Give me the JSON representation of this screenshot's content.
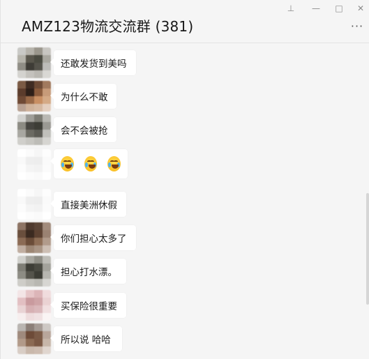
{
  "window": {
    "title": "AMZ123物流交流群 (381)",
    "controls": {
      "pin": "⊥",
      "minimize": "—",
      "maximize": "□",
      "close": "✕"
    },
    "more_label": "···"
  },
  "messages": [
    {
      "text": "还敢发货到美吗",
      "avatar": [
        "#c9c9c6",
        "#b6b3ab",
        "#9a968c",
        "#c8c6c1",
        "#b5b3aa",
        "#5a574d",
        "#4a4a40",
        "#a9a79f",
        "#8f8d85",
        "#3e3c36",
        "#55534b",
        "#bdbcb8",
        "#d4d3cf",
        "#c4c2bd",
        "#bab8b2",
        "#d9d8d4"
      ]
    },
    {
      "text": "为什么不敢",
      "avatar": [
        "#7b5b45",
        "#3f2c22",
        "#6c4a35",
        "#a17a5e",
        "#5b3c2c",
        "#2e2019",
        "#8a5b3c",
        "#c79b79",
        "#6f4a35",
        "#9a6a48",
        "#c88f63",
        "#d4aa86",
        "#b9a293",
        "#cfb29a",
        "#d5b9a2",
        "#e4cfbf"
      ]
    },
    {
      "text": "会不会被抢",
      "avatar": [
        "#d2d2cf",
        "#9f9e98",
        "#7d7c74",
        "#b9b8b3",
        "#8c8b83",
        "#464540",
        "#3d3d36",
        "#9a9993",
        "#a8a7a1",
        "#6b6a62",
        "#5b5a53",
        "#c1c0bb",
        "#d0cfcb",
        "#c7c6c1",
        "#bdbcb7",
        "#d6d5d1"
      ]
    },
    {
      "emoji": true,
      "count": 3,
      "emoji_name": "tears-of-joy-icon",
      "avatar": [
        "#ffffff",
        "#fbfbfb",
        "#f6f6f6",
        "#fdfdfd",
        "#f9f9f9",
        "#eeeeee",
        "#ededed",
        "#fafafa",
        "#fcfcfc",
        "#f4f4f4",
        "#f2f2f2",
        "#fbfbfb",
        "#ffffff",
        "#fcfcfc",
        "#fafafa",
        "#ffffff"
      ]
    },
    {
      "text": "直接美洲休假",
      "avatar": [
        "#ffffff",
        "#fbfbfb",
        "#f6f6f6",
        "#fdfdfd",
        "#f9f9f9",
        "#eeeeee",
        "#ededed",
        "#fafafa",
        "#fcfcfc",
        "#f4f4f4",
        "#f2f2f2",
        "#fbfbfb",
        "#ffffff",
        "#fcfcfc",
        "#fafafa",
        "#ffffff"
      ]
    },
    {
      "text": "你们担心太多了",
      "avatar": [
        "#8d7464",
        "#4e3a2e",
        "#5a4537",
        "#a18b7c",
        "#6a4f3d",
        "#3b2a20",
        "#5c4131",
        "#9a8272",
        "#8b6b55",
        "#6a4c38",
        "#8d6d55",
        "#b19b8b",
        "#c0aea1",
        "#9c8674",
        "#a99585",
        "#cdbfb4"
      ]
    },
    {
      "text": "担心打水漂。",
      "avatar": [
        "#cfcfcb",
        "#a7a69f",
        "#8f8e86",
        "#bebdb7",
        "#7e7d75",
        "#3d3d36",
        "#4a4a42",
        "#a3a29b",
        "#8d8c84",
        "#55544c",
        "#3c3c35",
        "#b7b6b0",
        "#cecdc8",
        "#c1c0ba",
        "#b8b7b1",
        "#d7d6d2"
      ]
    },
    {
      "text": "买保险很重要",
      "avatar": [
        "#f3e5e6",
        "#e6c6c8",
        "#dcb5b8",
        "#f0dcdd",
        "#e2bfc2",
        "#c99a9e",
        "#cfa4a7",
        "#ead2d3",
        "#e9d3d4",
        "#d6b0b3",
        "#dab8bb",
        "#f1e0e1",
        "#f7eeee",
        "#eedcdd",
        "#f0e1e2",
        "#faf4f4"
      ]
    },
    {
      "text": "所以说 哈哈",
      "avatar": [
        "#b9b5b1",
        "#8b7f78",
        "#a59b95",
        "#cdc8c4",
        "#9f8a7d",
        "#6d4b38",
        "#7a5a46",
        "#b8a69b",
        "#b29a89",
        "#8b6a53",
        "#7a5844",
        "#c7b6a9",
        "#d8cdc5",
        "#c9b8ab",
        "#cdbcb0",
        "#e0d6cf"
      ]
    }
  ]
}
